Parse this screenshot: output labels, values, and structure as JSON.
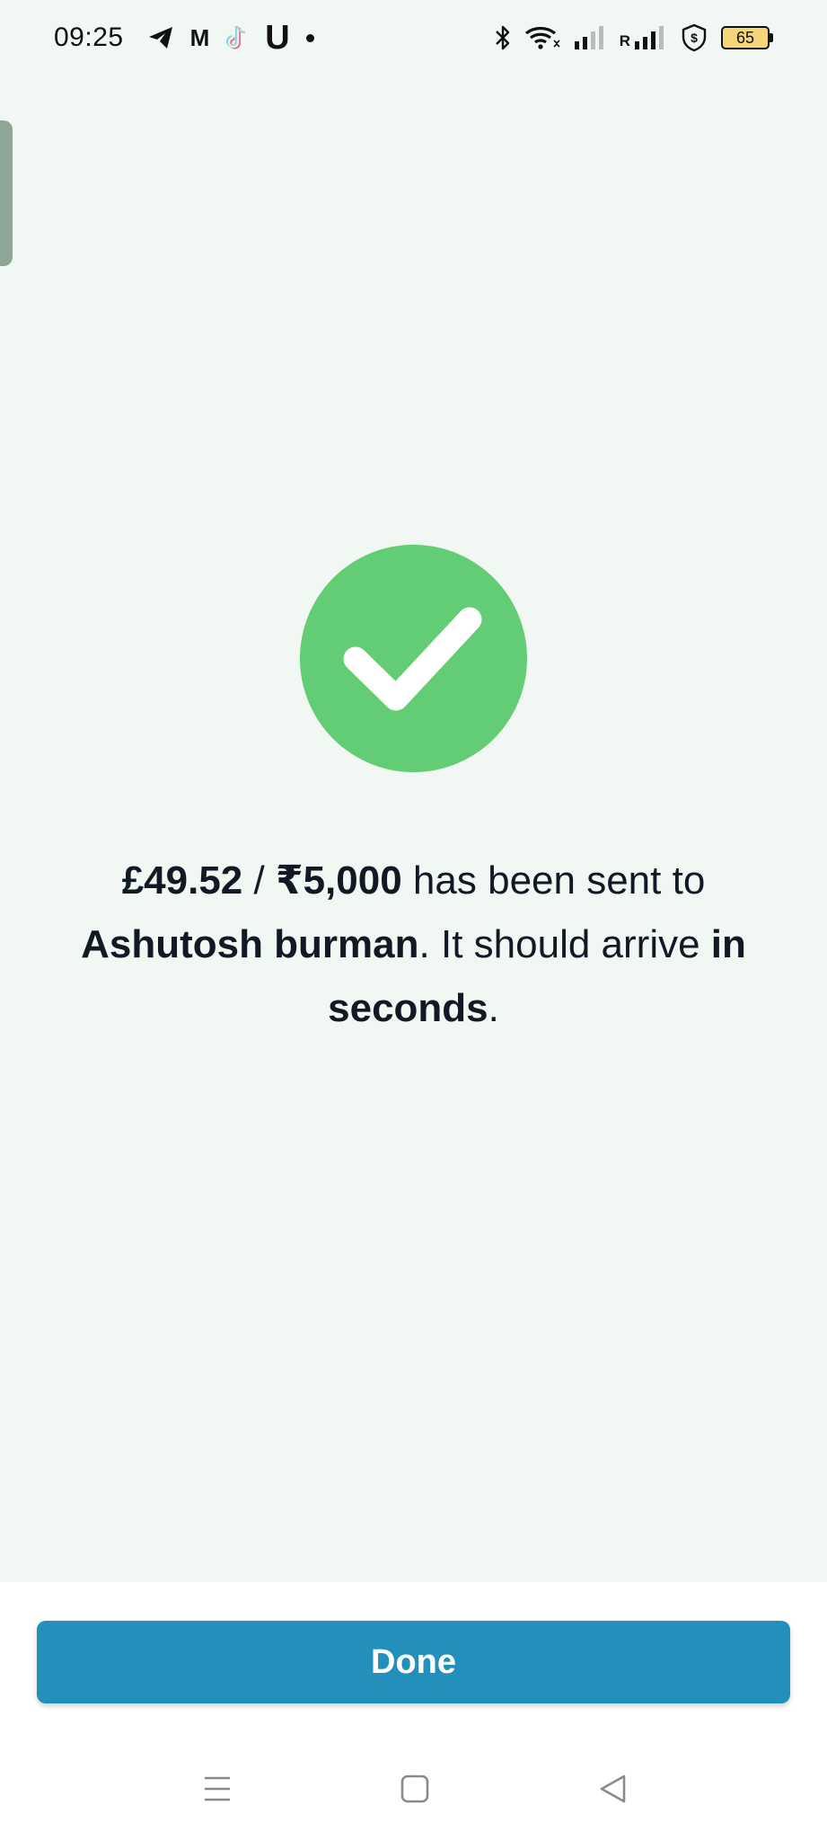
{
  "status_bar": {
    "time": "09:25",
    "left_icons": [
      "telegram-icon",
      "gmail-icon",
      "tiktok-icon",
      "uber-icon",
      "notification-dot-icon"
    ],
    "m_glyph": "M",
    "u_glyph": "U",
    "right_icons": [
      "bluetooth-icon",
      "wifi-icon",
      "signal-icon",
      "signal-roaming-icon",
      "security-shield-icon",
      "battery-icon"
    ],
    "roaming_label": "R",
    "battery_level": "65"
  },
  "success": {
    "icon": "check-circle-icon",
    "amount_gbp": "£49.52",
    "separator": " / ",
    "amount_inr": "₹5,000",
    "text_sent_to": " has been sent to ",
    "recipient": "Ashutosh burman",
    "text_should": ". It should arrive ",
    "eta": "in seconds",
    "text_end": "."
  },
  "actions": {
    "done_label": "Done"
  },
  "nav": {
    "items": [
      "recent-apps-icon",
      "home-icon",
      "back-icon"
    ]
  },
  "colors": {
    "background": "#f1f7f3",
    "success_green": "#62cd74",
    "button_blue": "#238fbb",
    "text_dark": "#0f1a24"
  }
}
